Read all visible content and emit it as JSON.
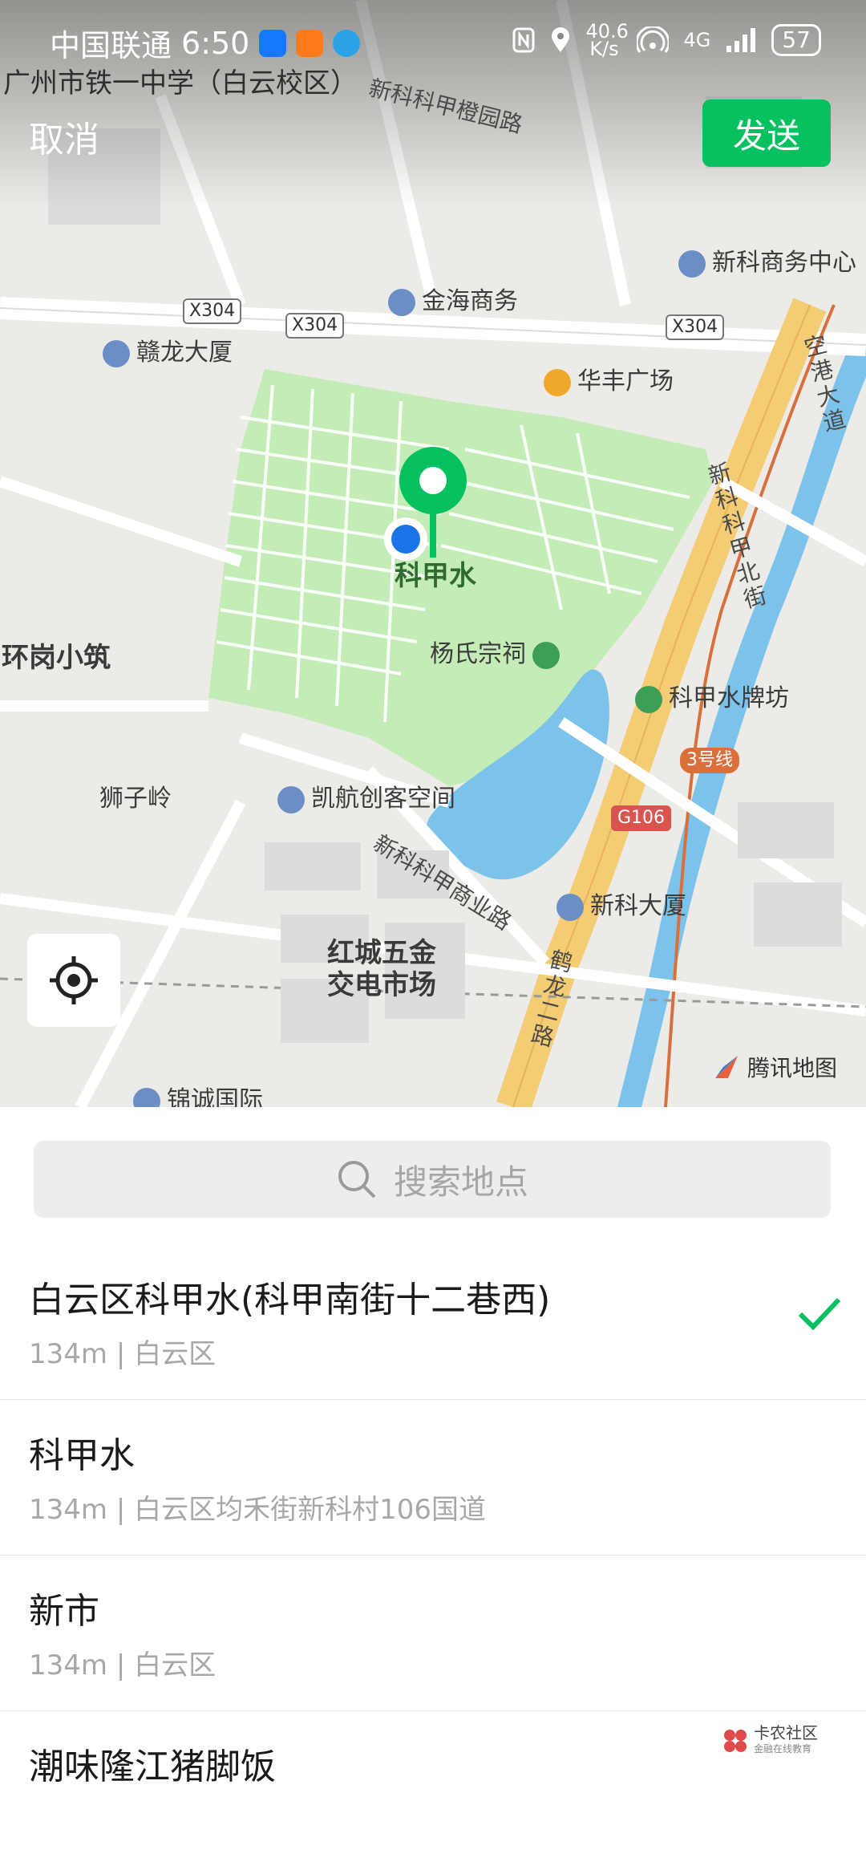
{
  "status_bar": {
    "carrier": "中国联通",
    "time": "6:50",
    "net_speed": "40.6 K/s",
    "signal": "4G",
    "battery": "57"
  },
  "header": {
    "cancel_label": "取消",
    "send_label": "发送"
  },
  "map": {
    "labels": {
      "school": "广州市铁一中学（白云校区）",
      "road_xinkekejia_cheng": "新科科甲橙园路",
      "xinke_business": "新科商务中心",
      "jinhai": "金海商务",
      "x304": "X304",
      "ganlong": "赣龙大厦",
      "huafeng": "华丰广场",
      "konggang": "空港大道",
      "kejiashui": "科甲水",
      "road_kejia_north": "新科科甲北街",
      "huangang": "环岗小筑",
      "yang_temple": "杨氏宗祠",
      "kejiashui_gate": "科甲水牌坊",
      "line3": "3号线",
      "g106": "G106",
      "shiziling": "狮子岭",
      "kaihang": "凯航创客空间",
      "road_xinkekejia_shang": "新科科甲商业路",
      "xinke_tower": "新科大厦",
      "hongcheng": "红城五金交电市场",
      "helong": "鹤龙二路",
      "jincheng": "锦诚国际",
      "tencent_map": "腾讯地图"
    }
  },
  "search": {
    "placeholder": "搜索地点"
  },
  "results": [
    {
      "title": "白云区科甲水(科甲南街十二巷西)",
      "subtitle": "134m | 白云区",
      "selected": true
    },
    {
      "title": "科甲水",
      "subtitle": "134m | 白云区均禾街新科村106国道",
      "selected": false
    },
    {
      "title": "新市",
      "subtitle": "134m | 白云区",
      "selected": false
    },
    {
      "title": "潮味隆江猪脚饭",
      "subtitle": "",
      "selected": false
    }
  ],
  "watermark": {
    "brand": "卡农社区",
    "tagline": "金融在线教育"
  },
  "colors": {
    "accent_green": "#07c160",
    "map_park": "#c4ecb7",
    "map_water": "#7cc3ec",
    "map_highway": "#f4cc74",
    "map_metro": "#d9703c"
  }
}
